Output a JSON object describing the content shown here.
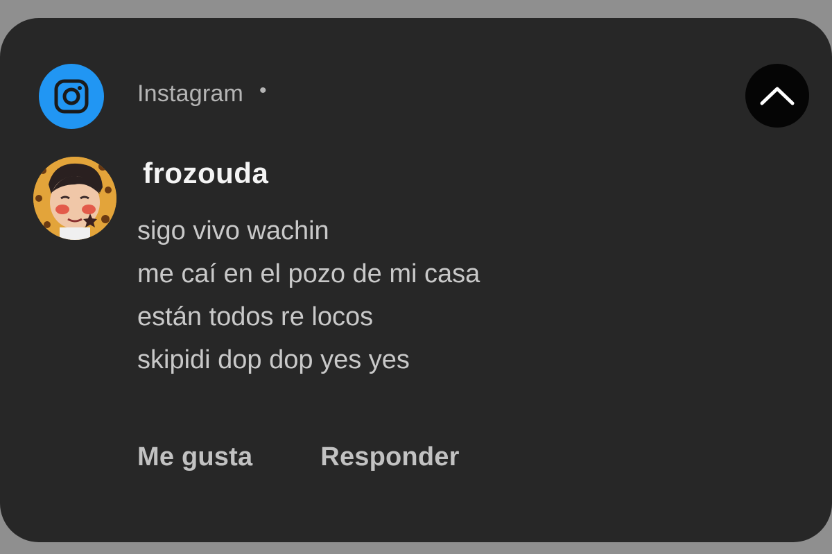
{
  "notification": {
    "app_name": "Instagram",
    "app_separator": "•",
    "app_icon": "instagram-icon",
    "collapse_icon": "chevron-up-icon",
    "sender": "frozouda",
    "message_lines": [
      "sigo vivo wachin",
      "me caí en el pozo de mi casa",
      "están todos re locos",
      "skipidi dop dop yes yes"
    ],
    "actions": {
      "like_label": "Me gusta",
      "reply_label": "Responder"
    }
  },
  "colors": {
    "card_background": "#272727",
    "instagram_icon_bg": "#2196f3",
    "collapse_button_bg": "#050505"
  }
}
